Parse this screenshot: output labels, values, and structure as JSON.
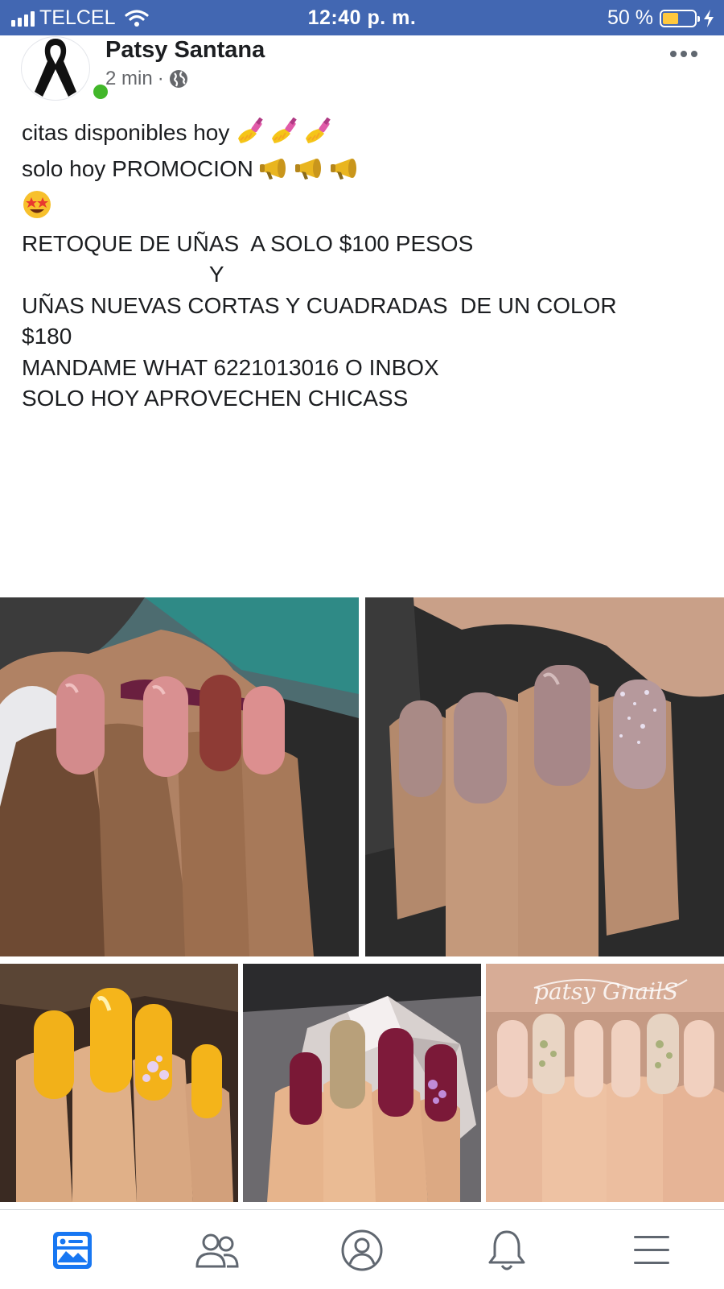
{
  "status_bar": {
    "carrier": "TELCEL",
    "time": "12:40 p. m.",
    "battery_percent": "50 %",
    "battery_level": 0.5,
    "background_color": "#4267b2"
  },
  "post": {
    "author": "Patsy Santana",
    "time_ago": "2 min",
    "separator": "·",
    "privacy_icon": "globe-icon",
    "more_icon": "more-dots-icon",
    "online": true,
    "lines": [
      "citas disponibles hoy",
      "",
      "solo hoy PROMOCION",
      "",
      "",
      "RETOQUE DE UÑAS  A SOLO $100 PESOS",
      "",
      "                              Y",
      "UÑAS NUEVAS CORTAS Y CUADRADAS  DE UN COLOR",
      "$180",
      "",
      "MANDAME WHAT 6221013016 O INBOX",
      "",
      "SOLO HOY APROVECHEN CHICASS"
    ],
    "emoji": {
      "line1": [
        "nail-polish",
        "nail-polish",
        "nail-polish"
      ],
      "line3": [
        "megaphone",
        "megaphone",
        "megaphone"
      ],
      "line4": [
        "star-struck"
      ]
    },
    "photos": [
      {
        "name": "photo-pink-nails",
        "description_icon": "nail-photo"
      },
      {
        "name": "photo-mauve-nails",
        "description_icon": "nail-photo"
      },
      {
        "name": "photo-yellow-nails",
        "description_icon": "nail-photo"
      },
      {
        "name": "photo-burgundy-nails",
        "description_icon": "nail-photo"
      },
      {
        "name": "photo-nude-glitter-nails",
        "description_icon": "nail-photo",
        "watermark": "patsy GnailS"
      }
    ]
  },
  "bottom_nav": {
    "items": [
      {
        "icon": "news-feed-icon",
        "active": true
      },
      {
        "icon": "friends-icon",
        "active": false
      },
      {
        "icon": "profile-icon",
        "active": false
      },
      {
        "icon": "notifications-bell-icon",
        "active": false
      },
      {
        "icon": "menu-icon",
        "active": false
      }
    ],
    "active_color": "#1877f2",
    "inactive_color": "#606770"
  }
}
